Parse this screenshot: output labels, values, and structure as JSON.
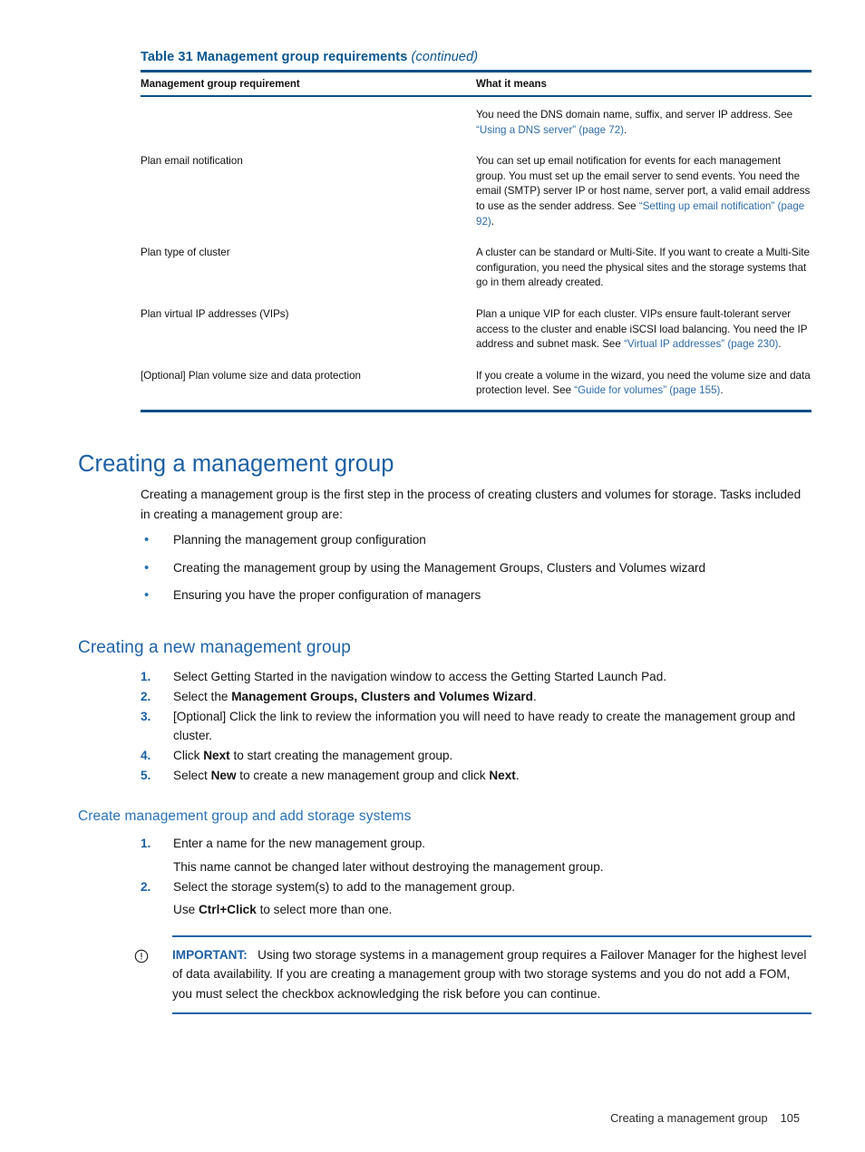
{
  "table": {
    "caption_main": "Table 31 Management group requirements",
    "caption_continued": "(continued)",
    "headers": [
      "Management group requirement",
      "What it means"
    ],
    "rows": [
      {
        "requirement": "",
        "means_parts": [
          {
            "t": "You need the DNS domain name, suffix, and server IP address. See ",
            "link": false
          },
          {
            "t": "“Using a DNS server” (page 72)",
            "link": true
          },
          {
            "t": ".",
            "link": false
          }
        ]
      },
      {
        "requirement": "Plan email notification",
        "means_parts": [
          {
            "t": "You can set up email notification for events for each management group. You must set up the email server to send events. You need the email (SMTP) server IP or host name, server port, a valid email address to use as the sender address. See ",
            "link": false
          },
          {
            "t": "“Setting up email notification” (page 92)",
            "link": true
          },
          {
            "t": ".",
            "link": false
          }
        ]
      },
      {
        "requirement": "Plan type of cluster",
        "means_parts": [
          {
            "t": "A cluster can be standard or Multi-Site. If you want to create a Multi-Site configuration, you need the physical sites and the storage systems that go in them already created.",
            "link": false
          }
        ]
      },
      {
        "requirement": "Plan virtual IP addresses (VIPs)",
        "means_parts": [
          {
            "t": "Plan a unique VIP for each cluster. VIPs ensure fault-tolerant server access to the cluster and enable iSCSI load balancing. You need the IP address and subnet mask. See ",
            "link": false
          },
          {
            "t": "“Virtual IP addresses” (page 230)",
            "link": true
          },
          {
            "t": ".",
            "link": false
          }
        ]
      },
      {
        "requirement": "[Optional] Plan volume size and data protection",
        "means_parts": [
          {
            "t": "If you create a volume in the wizard, you need the volume size and data protection level. See ",
            "link": false
          },
          {
            "t": "“Guide for volumes” (page 155)",
            "link": true
          },
          {
            "t": ".",
            "link": false
          }
        ]
      }
    ]
  },
  "section_main": {
    "title": "Creating a management group",
    "intro": "Creating a management group is the first step in the process of creating clusters and volumes for storage. Tasks included in creating a management group are:",
    "bullets": [
      "Planning the management group configuration",
      "Creating the management group by using the Management Groups, Clusters and Volumes wizard",
      "Ensuring you have the proper configuration of managers"
    ],
    "bullet_glyph": "•"
  },
  "section_new_group": {
    "title": "Creating a new management group",
    "steps": [
      {
        "num": "1.",
        "parts": [
          {
            "t": "Select Getting Started in the navigation window to access the Getting Started Launch Pad.",
            "b": false
          }
        ]
      },
      {
        "num": "2.",
        "parts": [
          {
            "t": "Select the ",
            "b": false
          },
          {
            "t": "Management Groups, Clusters and Volumes Wizard",
            "b": true
          },
          {
            "t": ".",
            "b": false
          }
        ]
      },
      {
        "num": "3.",
        "parts": [
          {
            "t": "[Optional] Click the link to review the information you will need to have ready to create the management group and cluster.",
            "b": false
          }
        ]
      },
      {
        "num": "4.",
        "parts": [
          {
            "t": "Click ",
            "b": false
          },
          {
            "t": "Next",
            "b": true
          },
          {
            "t": " to start creating the management group.",
            "b": false
          }
        ]
      },
      {
        "num": "5.",
        "parts": [
          {
            "t": "Select ",
            "b": false
          },
          {
            "t": "New",
            "b": true
          },
          {
            "t": " to create a new management group and click ",
            "b": false
          },
          {
            "t": "Next",
            "b": true
          },
          {
            "t": ".",
            "b": false
          }
        ]
      }
    ]
  },
  "section_create_group": {
    "title": "Create management group and add storage systems",
    "steps": [
      {
        "num": "1.",
        "parts": [
          {
            "t": "Enter a name for the new management group.",
            "b": false
          }
        ],
        "sub_parts": [
          {
            "t": "This name cannot be changed later without destroying the management group.",
            "b": false
          }
        ]
      },
      {
        "num": "2.",
        "parts": [
          {
            "t": "Select the storage system(s) to add to the management group.",
            "b": false
          }
        ],
        "sub_parts": [
          {
            "t": "Use ",
            "b": false
          },
          {
            "t": "Ctrl+Click",
            "b": true
          },
          {
            "t": " to select more than one.",
            "b": false
          }
        ]
      }
    ]
  },
  "note": {
    "icon": "important-circle-exclamation-icon",
    "label": "IMPORTANT:",
    "text": "Using two storage systems in a management group requires a Failover Manager for the highest level of data availability. If you are creating a management group with two storage systems and you do not add a FOM, you must select the checkbox acknowledging the risk before you can continue."
  },
  "footer": {
    "chapter": "Creating a management group",
    "page_number": "105"
  },
  "colors": {
    "heading_blue": "#1b5fa3",
    "subheading_blue": "#2a72b5",
    "link_blue": "#2f6ca8",
    "rule_blue": "#0d4f86",
    "caption_blue": "#0a5691",
    "body_black": "#141414"
  }
}
